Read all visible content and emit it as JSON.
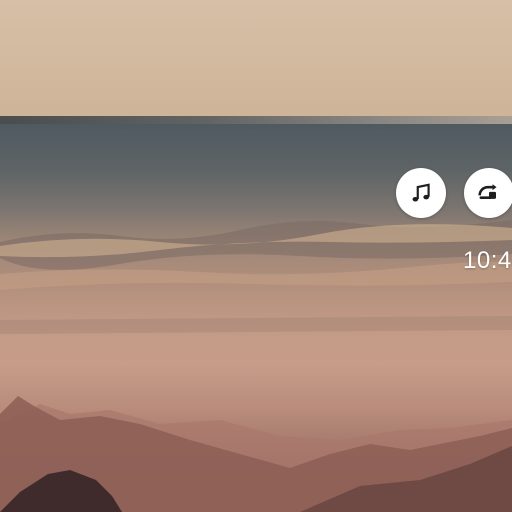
{
  "status": {
    "clock_text": "10:4"
  },
  "icons": {
    "music": "music-note-icon",
    "cast": "cast-connect-icon"
  },
  "colors": {
    "button_bg": "#ffffff",
    "icon_color": "#1f1f1f",
    "clock_color": "#ffffff"
  }
}
